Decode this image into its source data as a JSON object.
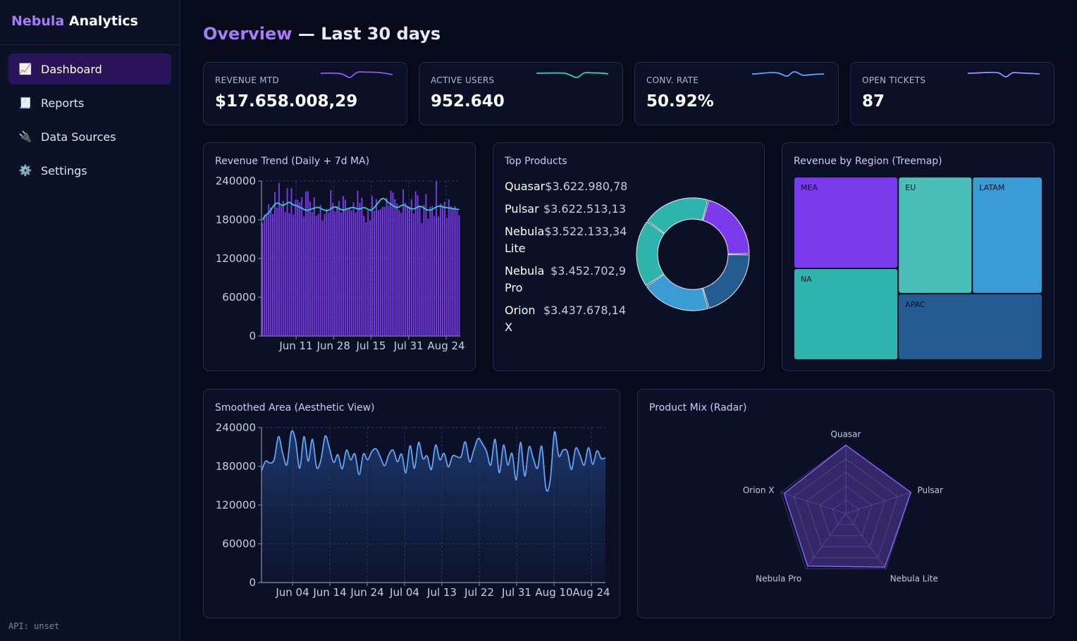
{
  "brand": {
    "accent": "Nebula",
    "rest": "Analytics"
  },
  "sidebar": {
    "items": [
      {
        "label": "Dashboard",
        "icon": "chart-icon",
        "glyph": "📈",
        "active": true
      },
      {
        "label": "Reports",
        "icon": "document-icon",
        "glyph": "🧾",
        "active": false
      },
      {
        "label": "Data Sources",
        "icon": "plug-icon",
        "glyph": "🔌",
        "active": false
      },
      {
        "label": "Settings",
        "icon": "gear-icon",
        "glyph": "⚙️",
        "active": false
      }
    ],
    "api_status": "API: unset"
  },
  "header": {
    "title_accent": "Overview",
    "title_rest": " — Last 30 days"
  },
  "kpis": [
    {
      "label": "REVENUE MTD",
      "value": "$17.658.008,29",
      "spark_color": "#8b5cf6"
    },
    {
      "label": "ACTIVE USERS",
      "value": "952.640",
      "spark_color": "#2dd4bf"
    },
    {
      "label": "CONV. RATE",
      "value": "50.92%",
      "spark_color": "#60a5fa"
    },
    {
      "label": "OPEN TICKETS",
      "value": "87",
      "spark_color": "#a78bfa"
    }
  ],
  "colors": {
    "accent": "#a47cf3",
    "purple": "#7c3aed",
    "teal": "#2fb3ad",
    "blue": "#3b9bd4",
    "navy": "#245b91",
    "line_blue": "#60a5fa"
  },
  "panels": {
    "trend_title": "Revenue Trend (Daily + 7d MA)",
    "products_title": "Top Products",
    "treemap_title": "Revenue by Region (Treemap)",
    "area_title": "Smoothed Area (Aesthetic View)",
    "radar_title": "Product Mix (Radar)"
  },
  "products": [
    {
      "name": "Quasar",
      "value": "$3.622.980,78"
    },
    {
      "name": "Pulsar",
      "value": "$3.622.513,13"
    },
    {
      "name": "Nebula Lite",
      "value": "$3.522.133,34"
    },
    {
      "name": "Nebula Pro",
      "value": "$3.452.702,9"
    },
    {
      "name": "Orion X",
      "value": "$3.437.678,14"
    }
  ],
  "chart_data": [
    {
      "type": "bar",
      "title": "Revenue Trend (Daily + 7d MA)",
      "y_ticks": [
        "0",
        "60000",
        "120000",
        "180000",
        "240000"
      ],
      "ylim": [
        0,
        240000
      ],
      "x_ticks": [
        "Jun 11",
        "Jun 28",
        "Jul 15",
        "Jul 31",
        "Aug 24"
      ],
      "grid": true,
      "series": [
        {
          "kind": "bar",
          "color": "#7c3aed",
          "values": [
            175000,
            188000,
            186000,
            204000,
            199000,
            189000,
            223000,
            199000,
            237000,
            201000,
            209000,
            192000,
            229000,
            190000,
            229000,
            188000,
            211000,
            211000,
            207000,
            215000,
            185000,
            224000,
            224000,
            208000,
            192000,
            215000,
            186000,
            189000,
            203000,
            179000,
            189000,
            197000,
            191000,
            226000,
            206000,
            193000,
            201000,
            209000,
            191000,
            217000,
            211000,
            197000,
            198000,
            194000,
            207000,
            191000,
            225000,
            206000,
            214000,
            186000,
            176000,
            194000,
            179000,
            217000,
            194000,
            212000,
            195000,
            196000,
            200000,
            200000,
            214000,
            202000,
            225000,
            222000,
            212000,
            205000,
            195000,
            191000,
            227000,
            206000,
            200000,
            201000,
            212000,
            190000,
            224000,
            218000,
            201000,
            175000,
            203000,
            220000,
            182000,
            200000,
            201000,
            186000,
            240000,
            185000,
            205000,
            203000,
            208000,
            183000,
            212000,
            201000,
            198000,
            201000,
            194000,
            187000
          ]
        },
        {
          "kind": "line",
          "name": "7d MA",
          "color": "#2dd4bf",
          "values": [
            180000,
            185000,
            188000,
            191000,
            195000,
            200000,
            204000,
            206000,
            205000,
            203000,
            202000,
            204000,
            206000,
            207000,
            205000,
            203000,
            202000,
            201000,
            199000,
            198000,
            196000,
            195000,
            195000,
            196000,
            197000,
            198000,
            199000,
            199000,
            198000,
            196000,
            195000,
            194000,
            195000,
            197000,
            199000,
            200000,
            199000,
            197000,
            196000,
            195000,
            196000,
            197000,
            198000,
            199000,
            199000,
            198000,
            197000,
            197000,
            198000,
            199000,
            198000,
            196000,
            195000,
            196000,
            199000,
            203000,
            207000,
            211000,
            213000,
            212000,
            209000,
            206000,
            204000,
            202000,
            200000,
            199000,
            200000,
            202000,
            203000,
            202000,
            200000,
            198000,
            197000,
            197000,
            198000,
            200000,
            201000,
            200000,
            198000,
            196000,
            195000,
            195000,
            196000,
            198000,
            200000,
            201000,
            201000,
            200000,
            199000,
            199000,
            198000,
            198000,
            197000,
            197000,
            196000,
            196000
          ]
        }
      ]
    },
    {
      "type": "pie",
      "title": "Top Products",
      "donut": true,
      "categories": [
        "Quasar",
        "Pulsar",
        "Nebula Lite",
        "Nebula Pro",
        "Orion X"
      ],
      "values": [
        3622980.78,
        3622513.13,
        3522133.34,
        3452702.9,
        3437678.14
      ],
      "colors": [
        "#7c3aed",
        "#245b91",
        "#3b9bd4",
        "#2fb3ad",
        "#2fb3ad"
      ]
    },
    {
      "type": "heatmap",
      "subtype": "treemap",
      "title": "Revenue by Region (Treemap)",
      "categories": [
        "MEA",
        "NA",
        "EU",
        "LATAM",
        "APAC"
      ],
      "values": [
        21,
        21,
        19,
        18,
        21
      ],
      "colors": [
        "#7c3aed",
        "#2fb3ad",
        "#4bbfb6",
        "#3b9bd4",
        "#245b91"
      ]
    },
    {
      "type": "area",
      "title": "Smoothed Area (Aesthetic View)",
      "y_ticks": [
        "0",
        "60000",
        "120000",
        "180000",
        "240000"
      ],
      "ylim": [
        0,
        240000
      ],
      "x_ticks": [
        "Jun 04",
        "Jun 14",
        "Jun 24",
        "Jul 04",
        "Jul 13",
        "Jul 22",
        "Jul 31",
        "Aug 10",
        "Aug 24"
      ],
      "grid": true,
      "color": "#60a5fa",
      "values": [
        173000,
        188000,
        185000,
        191000,
        226000,
        200000,
        183000,
        233000,
        221000,
        177000,
        226000,
        188000,
        222000,
        178000,
        190000,
        227000,
        208000,
        186000,
        198000,
        176000,
        205000,
        190000,
        199000,
        167000,
        199000,
        190000,
        203000,
        207000,
        194000,
        181000,
        198000,
        205000,
        187000,
        199000,
        170000,
        212000,
        177000,
        217000,
        192000,
        196000,
        175000,
        213000,
        190000,
        200000,
        179000,
        196000,
        195000,
        195000,
        218000,
        187000,
        205000,
        223000,
        215000,
        203000,
        182000,
        222000,
        170000,
        213000,
        182000,
        200000,
        159000,
        217000,
        165000,
        210000,
        192000,
        177000,
        211000,
        145000,
        159000,
        233000,
        196000,
        205000,
        203000,
        175000,
        208000,
        197000,
        182000,
        209000,
        183000,
        204000,
        192000,
        193000
      ]
    },
    {
      "type": "radar",
      "title": "Product Mix (Radar)",
      "categories": [
        "Quasar",
        "Pulsar",
        "Nebula Lite",
        "Nebula Pro",
        "Orion X"
      ],
      "values": [
        1.0,
        1.0,
        0.97,
        0.95,
        0.95
      ],
      "color": "#8b5cf6"
    }
  ]
}
